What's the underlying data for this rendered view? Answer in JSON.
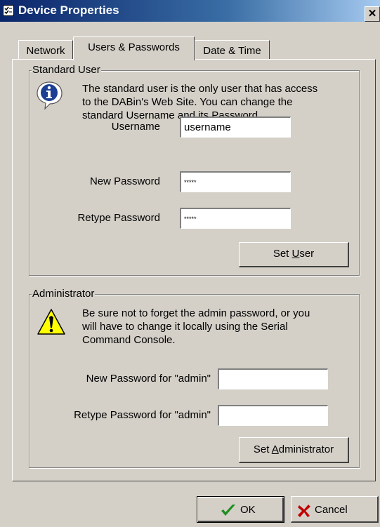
{
  "window": {
    "title": "Device Properties",
    "close_glyph": "✕"
  },
  "tabs": [
    {
      "label": "Network",
      "active": false
    },
    {
      "label": "Users & Passwords",
      "active": true
    },
    {
      "label": "Date & Time",
      "active": false
    }
  ],
  "standard_user": {
    "group_title": "Standard User",
    "info_text_lines": [
      "The standard user is the only user that has access",
      "to the DABin's Web Site. You can change the",
      "standard Username and its Password."
    ],
    "username_label": "Username",
    "username_value": "username",
    "new_password_label": "New Password",
    "new_password_value": "*****",
    "retype_password_label": "Retype Password",
    "retype_password_value": "*****",
    "set_button": {
      "prefix": "Set ",
      "mnemonic": "U",
      "suffix": "ser"
    }
  },
  "administrator": {
    "group_title": "Administrator",
    "warning_text_lines": [
      "Be sure not to forget the admin password, or you",
      "will have to change it locally using the Serial",
      "Command Console."
    ],
    "new_password_label": "New Password for \"admin\"",
    "new_password_value": "",
    "retype_password_label": "Retype Password for \"admin\"",
    "retype_password_value": "",
    "set_button": {
      "prefix": "Set ",
      "mnemonic": "A",
      "suffix": "dministrator"
    }
  },
  "footer": {
    "ok_label": "OK",
    "cancel_label": "Cancel"
  },
  "icons": {
    "info": "info-icon",
    "warning": "warning-icon",
    "ok": "checkmark-icon",
    "cancel": "x-icon"
  },
  "colors": {
    "dialog_bg": "#d4d0c8",
    "titlebar_start": "#0a246a",
    "titlebar_end": "#a6caf0",
    "ok_check": "#1f8f1f",
    "cancel_x": "#c00000",
    "info_blue": "#1c3f94",
    "warning_yellow": "#ffff00"
  }
}
